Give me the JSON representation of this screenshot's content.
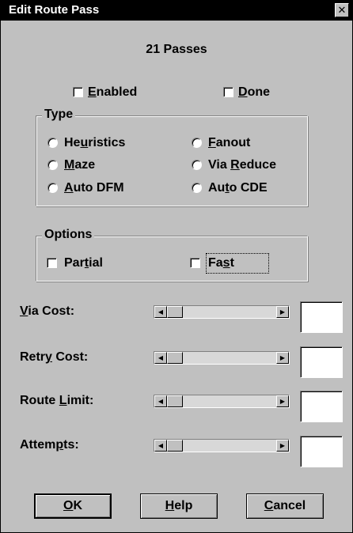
{
  "window": {
    "title": "Edit Route Pass",
    "close_glyph": "✕"
  },
  "header": {
    "passes_text": "21 Passes"
  },
  "checks": {
    "enabled": {
      "pre": "",
      "u": "E",
      "post": "nabled",
      "checked": false
    },
    "done": {
      "pre": "",
      "u": "D",
      "post": "one",
      "checked": false
    }
  },
  "type_group": {
    "title": "Type",
    "options": [
      {
        "pre": "He",
        "u": "u",
        "post": "ristics"
      },
      {
        "pre": "",
        "u": "F",
        "post": "anout"
      },
      {
        "pre": "",
        "u": "M",
        "post": "aze"
      },
      {
        "pre": "Via ",
        "u": "R",
        "post": "educe"
      },
      {
        "pre": "",
        "u": "A",
        "post": "uto DFM"
      },
      {
        "pre": "Au",
        "u": "t",
        "post": "o CDE"
      }
    ]
  },
  "options_group": {
    "title": "Options",
    "partial": {
      "pre": "Par",
      "u": "t",
      "post": "ial",
      "checked": false
    },
    "fast": {
      "pre": "Fa",
      "u": "s",
      "post": "t",
      "checked": false
    }
  },
  "sliders": [
    {
      "pre": "",
      "u": "V",
      "post": "ia Cost:",
      "value": ""
    },
    {
      "pre": "Retr",
      "u": "y",
      "post": " Cost:",
      "value": ""
    },
    {
      "pre": "Route ",
      "u": "L",
      "post": "imit:",
      "value": ""
    },
    {
      "pre": "Attem",
      "u": "p",
      "post": "ts:",
      "value": ""
    }
  ],
  "buttons": {
    "ok": {
      "pre": "",
      "u": "O",
      "post": "K"
    },
    "help": {
      "pre": "",
      "u": "H",
      "post": "elp"
    },
    "cancel": {
      "pre": "",
      "u": "C",
      "post": "ancel"
    }
  },
  "icons": {
    "arrow_left": "◀",
    "arrow_right": "▶"
  },
  "colors": {
    "face": "#c0c0c0",
    "title_bg": "#000000",
    "title_fg": "#ffffff"
  }
}
